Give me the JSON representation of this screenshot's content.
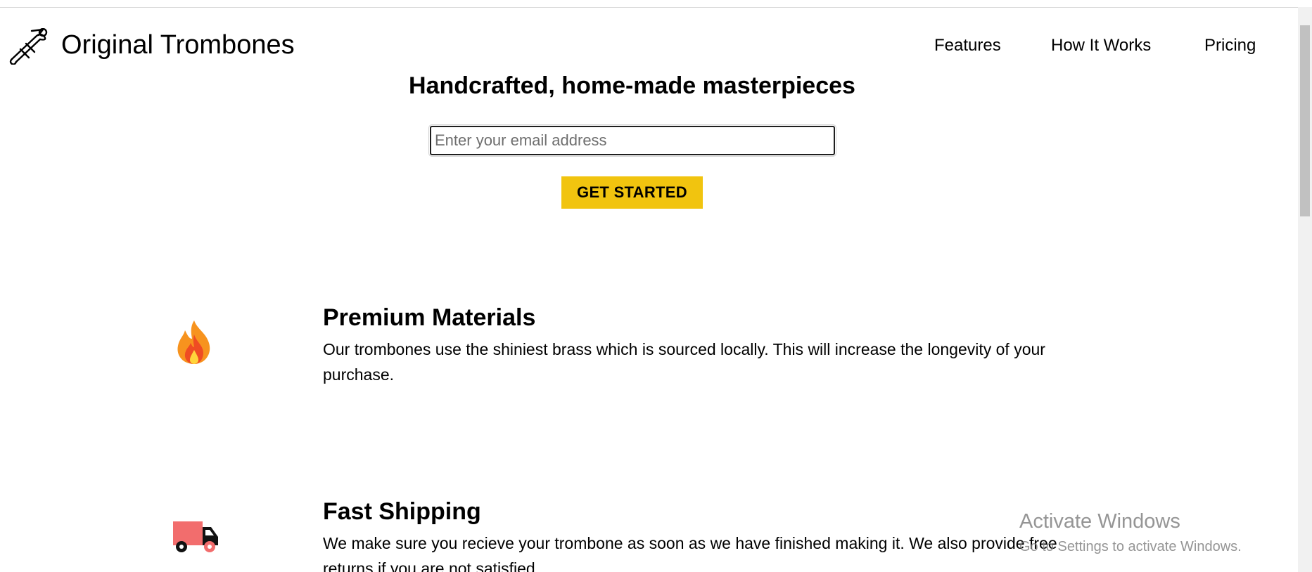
{
  "header": {
    "logo_text": "Original Trombones",
    "logo_icon": "trombone-icon",
    "nav": [
      {
        "label": "Features"
      },
      {
        "label": "How It Works"
      },
      {
        "label": "Pricing"
      }
    ]
  },
  "hero": {
    "title": "Handcrafted, home-made masterpieces",
    "email_placeholder": "Enter your email address",
    "cta_label": "GET STARTED"
  },
  "features": [
    {
      "icon": "fire-icon",
      "title": "Premium Materials",
      "description": "Our trombones use the shiniest brass which is sourced locally. This will increase the longevity of your purchase."
    },
    {
      "icon": "truck-icon",
      "title": "Fast Shipping",
      "description": "We make sure you recieve your trombone as soon as we have finished making it. We also provide free returns if you are not satisfied."
    }
  ],
  "watermark": {
    "title": "Activate Windows",
    "subtitle": "Go to Settings to activate Windows."
  },
  "colors": {
    "cta_background": "#f1c40f",
    "fire_orange": "#f7931e",
    "truck_red": "#f26d6d"
  }
}
